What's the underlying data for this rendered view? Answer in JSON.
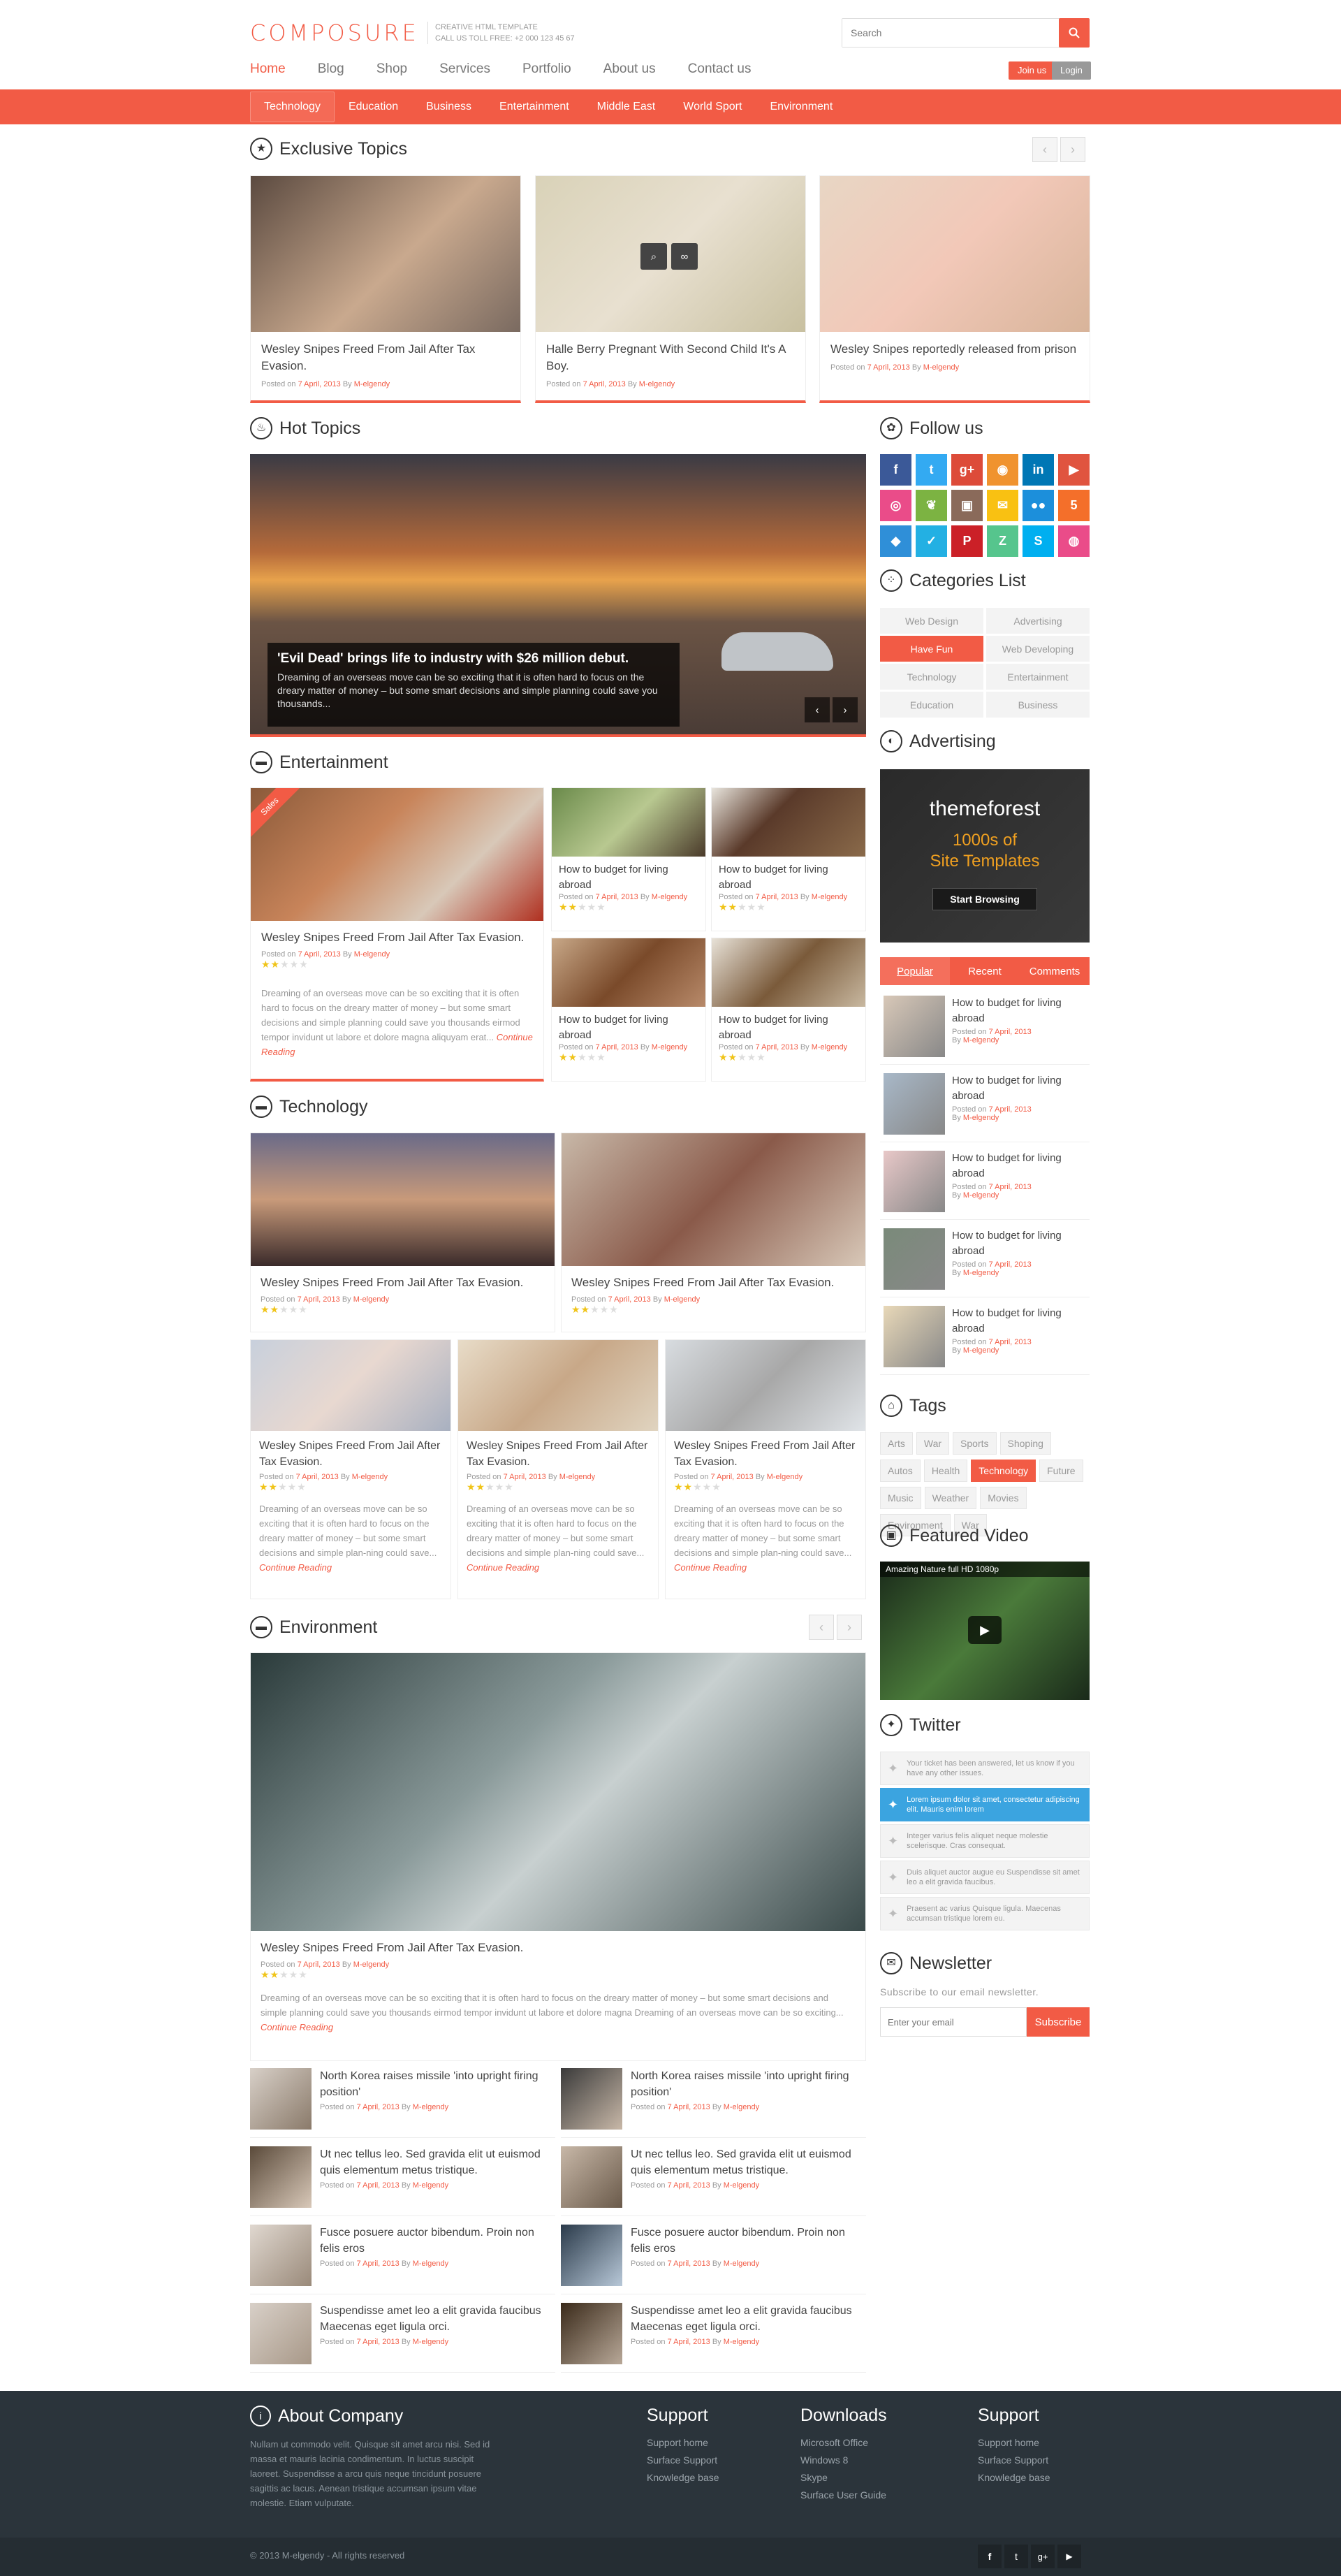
{
  "header": {
    "logo": "COMPOSURE",
    "tagline1": "CREATIVE HTML TEMPLATE",
    "tagline2": "CALL US TOLL FREE: +2 000 123 45 67",
    "search_placeholder": "Search",
    "nav": [
      "Home",
      "Blog",
      "Shop",
      "Services",
      "Portfolio",
      "About us",
      "Contact us"
    ],
    "join": "Join us",
    "login": "Login"
  },
  "subnav": [
    "Technology",
    "Education",
    "Business",
    "Entertainment",
    "Middle East",
    "World Sport",
    "Environment"
  ],
  "exclusive": {
    "title": "Exclusive Topics",
    "cards": [
      {
        "title": "Wesley Snipes Freed From Jail After Tax Evasion.",
        "posted": "Posted on",
        "date": "7 April, 2013",
        "by": "By",
        "author": "M-elgendy"
      },
      {
        "title": "Halle Berry Pregnant With Second Child It's A Boy.",
        "posted": "Posted on",
        "date": "7 April, 2013",
        "by": "By",
        "author": "M-elgendy"
      },
      {
        "title": "Wesley Snipes reportedly released from prison",
        "posted": "Posted on",
        "date": "7 April, 2013",
        "by": "By",
        "author": "M-elgendy"
      }
    ]
  },
  "hot": {
    "title": "Hot Topics",
    "caption_title": "'Evil Dead' brings life to industry with $26 million debut.",
    "caption_text": "Dreaming of an overseas move can be so exciting that it is often hard to focus on the dreary matter of money – but some smart decisions and simple planning could save you thousands..."
  },
  "entertainment": {
    "title": "Entertainment",
    "ribbon": "Sales",
    "main_title": "Wesley Snipes Freed From Jail After Tax Evasion.",
    "main_excerpt": "Dreaming of an overseas move can be so exciting that it is often hard to focus on the dreary matter of money – but some smart decisions and simple planning could save you thousands eirmod tempor invidunt ut labore et dolore magna aliquyam erat...",
    "more": "Continue Reading",
    "posted": "Posted on",
    "date": "7 April, 2013",
    "by": "By",
    "author": "M-elgendy",
    "small": [
      "How to budget for living abroad",
      "How to budget for living abroad",
      "How to budget for living abroad",
      "How to budget for living abroad"
    ]
  },
  "technology": {
    "title": "Technology",
    "top": [
      "Wesley Snipes Freed From Jail After Tax Evasion.",
      "Wesley Snipes Freed From Jail After Tax Evasion."
    ],
    "bottom": [
      "Wesley Snipes Freed From Jail After Tax Evasion.",
      "Wesley Snipes Freed From Jail After Tax Evasion.",
      "Wesley Snipes Freed From Jail After Tax Evasion."
    ],
    "excerpt": "Dreaming of an overseas move can be so exciting that it is often hard to focus on the dreary matter of money – but some smart decisions and simple plan-ning could save...",
    "more": "Continue Reading",
    "posted": "Posted on",
    "date": "7 April, 2013",
    "by": "By",
    "author": "M-elgendy"
  },
  "environment": {
    "title": "Environment",
    "main_title": "Wesley Snipes Freed From Jail After Tax Evasion.",
    "excerpt": "Dreaming of an overseas move can be so exciting that it is often hard to focus on the dreary matter of money – but some smart decisions and simple planning could save you thousands eirmod tempor invidunt ut labore et dolore magna Dreaming of an overseas move can be so exciting...",
    "more": "Continue Reading",
    "posted": "Posted on",
    "date": "7 April, 2013",
    "by": "By",
    "author": "M-elgendy",
    "list": [
      "North Korea raises missile 'into upright firing position'",
      "North Korea raises missile 'into upright firing position'",
      "Ut nec tellus leo. Sed gravida elit ut euismod quis elementum metus tristique.",
      "Ut nec tellus leo. Sed gravida elit ut euismod quis elementum metus tristique.",
      "Fusce posuere auctor bibendum. Proin non felis eros",
      "Fusce posuere auctor bibendum. Proin non felis eros",
      "Suspendisse amet leo a elit gravida faucibus Maecenas eget ligula orci.",
      "Suspendisse amet leo a elit gravida faucibus Maecenas eget ligula orci."
    ]
  },
  "sidebar": {
    "follow": "Follow us",
    "categories_title": "Categories List",
    "categories": [
      "Web Design",
      "Advertising",
      "Have Fun",
      "Web Developing",
      "Technology",
      "Entertainment",
      "Education",
      "Business"
    ],
    "advertising": "Advertising",
    "ad_brand": "themeforest",
    "ad_line1": "1000s of",
    "ad_line2": "Site Templates",
    "ad_button": "Start Browsing",
    "tabs": [
      "Popular",
      "Recent",
      "Comments"
    ],
    "popular_item": "How to budget for living abroad",
    "posted": "Posted on",
    "date": "7 April, 2013",
    "by": "By",
    "author": "M-elgendy",
    "tags_title": "Tags",
    "tags": [
      "Arts",
      "War",
      "Sports",
      "Shoping",
      "Autos",
      "Health",
      "Technology",
      "Future",
      "Music",
      "Weather",
      "Movies",
      "Environment",
      "War"
    ],
    "video_title": "Featured Video",
    "video_caption": "Amazing Nature full HD 1080p",
    "twitter_title": "Twitter",
    "tweets": [
      "Your ticket has been answered, let us know if you have any other issues.",
      "Lorem ipsum dolor sit amet, consectetur adipiscing elit. Mauris enim lorem",
      "Integer varius felis aliquet neque molestie scelerisque. Cras consequat.",
      "Duis aliquet auctor augue eu Suspendisse sit amet leo a elit gravida faucibus.",
      "Praesent ac varius Quisque ligula. Maecenas accumsan tristique lorem eu."
    ],
    "newsletter_title": "Newsletter",
    "newsletter_text": "Subscribe to our email newsletter.",
    "email_placeholder": "Enter your email",
    "subscribe": "Subscribe"
  },
  "footer": {
    "about_title": "About Company",
    "about_text": "Nullam ut commodo velit. Quisque sit amet arcu nisi. Sed id massa et mauris lacinia condimentum. In luctus suscipit laoreet. Suspendisse a arcu quis neque tincidunt posuere sagittis ac lacus. Aenean tristique accumsan ipsum vitae molestie. Etiam vulputate.",
    "col1_title": "Support",
    "col1": [
      "Support home",
      "Surface Support",
      "Knowledge base"
    ],
    "col2_title": "Downloads",
    "col2": [
      "Microsoft Office",
      "Windows 8",
      "Skype",
      "Surface User Guide"
    ],
    "col3_title": "Support",
    "col3": [
      "Support home",
      "Surface Support",
      "Knowledge base"
    ],
    "copyright": "© 2013 M-elgendy - All rights reserved"
  },
  "colors": {
    "accent": "#f25b45",
    "footer": "#2b343b"
  }
}
